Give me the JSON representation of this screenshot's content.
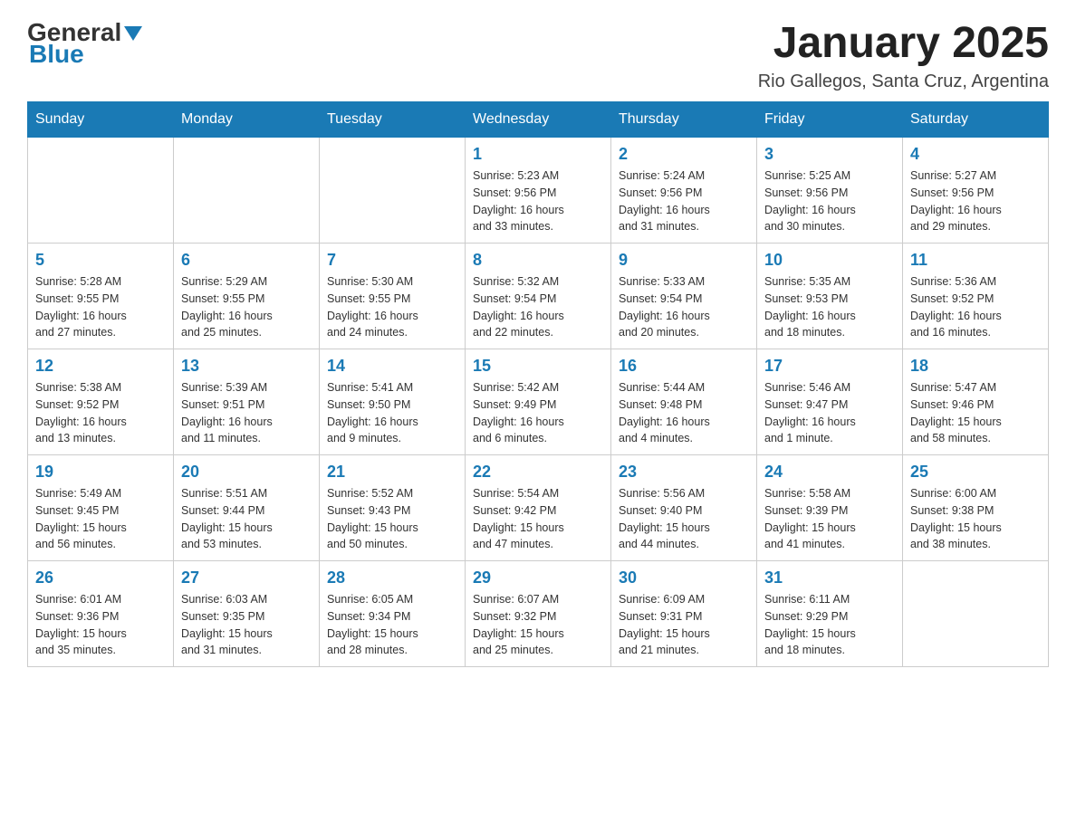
{
  "header": {
    "logo": {
      "general": "General",
      "blue": "Blue"
    },
    "month": "January 2025",
    "location": "Rio Gallegos, Santa Cruz, Argentina"
  },
  "days_of_week": [
    "Sunday",
    "Monday",
    "Tuesday",
    "Wednesday",
    "Thursday",
    "Friday",
    "Saturday"
  ],
  "weeks": [
    [
      {
        "day": "",
        "info": ""
      },
      {
        "day": "",
        "info": ""
      },
      {
        "day": "",
        "info": ""
      },
      {
        "day": "1",
        "info": "Sunrise: 5:23 AM\nSunset: 9:56 PM\nDaylight: 16 hours\nand 33 minutes."
      },
      {
        "day": "2",
        "info": "Sunrise: 5:24 AM\nSunset: 9:56 PM\nDaylight: 16 hours\nand 31 minutes."
      },
      {
        "day": "3",
        "info": "Sunrise: 5:25 AM\nSunset: 9:56 PM\nDaylight: 16 hours\nand 30 minutes."
      },
      {
        "day": "4",
        "info": "Sunrise: 5:27 AM\nSunset: 9:56 PM\nDaylight: 16 hours\nand 29 minutes."
      }
    ],
    [
      {
        "day": "5",
        "info": "Sunrise: 5:28 AM\nSunset: 9:55 PM\nDaylight: 16 hours\nand 27 minutes."
      },
      {
        "day": "6",
        "info": "Sunrise: 5:29 AM\nSunset: 9:55 PM\nDaylight: 16 hours\nand 25 minutes."
      },
      {
        "day": "7",
        "info": "Sunrise: 5:30 AM\nSunset: 9:55 PM\nDaylight: 16 hours\nand 24 minutes."
      },
      {
        "day": "8",
        "info": "Sunrise: 5:32 AM\nSunset: 9:54 PM\nDaylight: 16 hours\nand 22 minutes."
      },
      {
        "day": "9",
        "info": "Sunrise: 5:33 AM\nSunset: 9:54 PM\nDaylight: 16 hours\nand 20 minutes."
      },
      {
        "day": "10",
        "info": "Sunrise: 5:35 AM\nSunset: 9:53 PM\nDaylight: 16 hours\nand 18 minutes."
      },
      {
        "day": "11",
        "info": "Sunrise: 5:36 AM\nSunset: 9:52 PM\nDaylight: 16 hours\nand 16 minutes."
      }
    ],
    [
      {
        "day": "12",
        "info": "Sunrise: 5:38 AM\nSunset: 9:52 PM\nDaylight: 16 hours\nand 13 minutes."
      },
      {
        "day": "13",
        "info": "Sunrise: 5:39 AM\nSunset: 9:51 PM\nDaylight: 16 hours\nand 11 minutes."
      },
      {
        "day": "14",
        "info": "Sunrise: 5:41 AM\nSunset: 9:50 PM\nDaylight: 16 hours\nand 9 minutes."
      },
      {
        "day": "15",
        "info": "Sunrise: 5:42 AM\nSunset: 9:49 PM\nDaylight: 16 hours\nand 6 minutes."
      },
      {
        "day": "16",
        "info": "Sunrise: 5:44 AM\nSunset: 9:48 PM\nDaylight: 16 hours\nand 4 minutes."
      },
      {
        "day": "17",
        "info": "Sunrise: 5:46 AM\nSunset: 9:47 PM\nDaylight: 16 hours\nand 1 minute."
      },
      {
        "day": "18",
        "info": "Sunrise: 5:47 AM\nSunset: 9:46 PM\nDaylight: 15 hours\nand 58 minutes."
      }
    ],
    [
      {
        "day": "19",
        "info": "Sunrise: 5:49 AM\nSunset: 9:45 PM\nDaylight: 15 hours\nand 56 minutes."
      },
      {
        "day": "20",
        "info": "Sunrise: 5:51 AM\nSunset: 9:44 PM\nDaylight: 15 hours\nand 53 minutes."
      },
      {
        "day": "21",
        "info": "Sunrise: 5:52 AM\nSunset: 9:43 PM\nDaylight: 15 hours\nand 50 minutes."
      },
      {
        "day": "22",
        "info": "Sunrise: 5:54 AM\nSunset: 9:42 PM\nDaylight: 15 hours\nand 47 minutes."
      },
      {
        "day": "23",
        "info": "Sunrise: 5:56 AM\nSunset: 9:40 PM\nDaylight: 15 hours\nand 44 minutes."
      },
      {
        "day": "24",
        "info": "Sunrise: 5:58 AM\nSunset: 9:39 PM\nDaylight: 15 hours\nand 41 minutes."
      },
      {
        "day": "25",
        "info": "Sunrise: 6:00 AM\nSunset: 9:38 PM\nDaylight: 15 hours\nand 38 minutes."
      }
    ],
    [
      {
        "day": "26",
        "info": "Sunrise: 6:01 AM\nSunset: 9:36 PM\nDaylight: 15 hours\nand 35 minutes."
      },
      {
        "day": "27",
        "info": "Sunrise: 6:03 AM\nSunset: 9:35 PM\nDaylight: 15 hours\nand 31 minutes."
      },
      {
        "day": "28",
        "info": "Sunrise: 6:05 AM\nSunset: 9:34 PM\nDaylight: 15 hours\nand 28 minutes."
      },
      {
        "day": "29",
        "info": "Sunrise: 6:07 AM\nSunset: 9:32 PM\nDaylight: 15 hours\nand 25 minutes."
      },
      {
        "day": "30",
        "info": "Sunrise: 6:09 AM\nSunset: 9:31 PM\nDaylight: 15 hours\nand 21 minutes."
      },
      {
        "day": "31",
        "info": "Sunrise: 6:11 AM\nSunset: 9:29 PM\nDaylight: 15 hours\nand 18 minutes."
      },
      {
        "day": "",
        "info": ""
      }
    ]
  ]
}
